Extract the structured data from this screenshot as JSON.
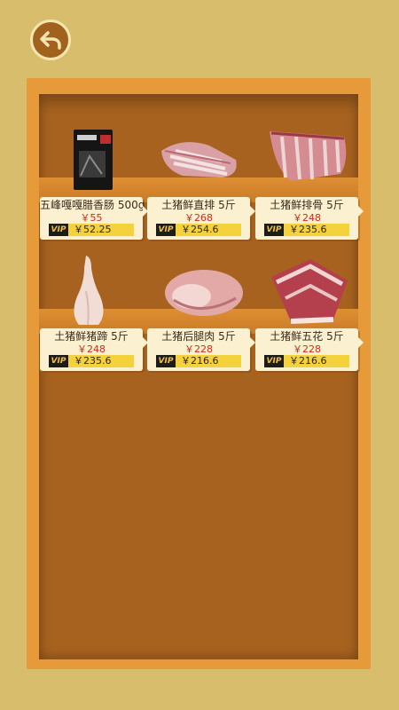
{
  "header": {
    "back_icon": "back-arrow-icon"
  },
  "colors": {
    "background": "#d8be6c",
    "cabinet": "#e79a3a",
    "cabinet_inner": "#a8621f",
    "price_red": "#d6281d",
    "vip_yellow": "#f4d23b"
  },
  "products": [
    {
      "name": "五峰嘎嘎腊香肠 500g",
      "price": "￥55",
      "vip_label": "VIP",
      "vip_price": "￥52.25",
      "image": "sausage-package-image"
    },
    {
      "name": "土猪鲜直排 5斤",
      "price": "￥268",
      "vip_label": "VIP",
      "vip_price": "￥254.6",
      "image": "pork-ribs-image"
    },
    {
      "name": "土猪鲜排骨 5斤",
      "price": "￥248",
      "vip_label": "VIP",
      "vip_price": "￥235.6",
      "image": "spare-ribs-image"
    },
    {
      "name": "土猪鲜猪蹄 5斤",
      "price": "￥248",
      "vip_label": "VIP",
      "vip_price": "￥235.6",
      "image": "pig-trotter-image"
    },
    {
      "name": "土猪后腿肉 5斤",
      "price": "￥228",
      "vip_label": "VIP",
      "vip_price": "￥216.6",
      "image": "hind-leg-pork-image"
    },
    {
      "name": "土猪鲜五花 5斤",
      "price": "￥228",
      "vip_label": "VIP",
      "vip_price": "￥216.6",
      "image": "pork-belly-image"
    }
  ]
}
